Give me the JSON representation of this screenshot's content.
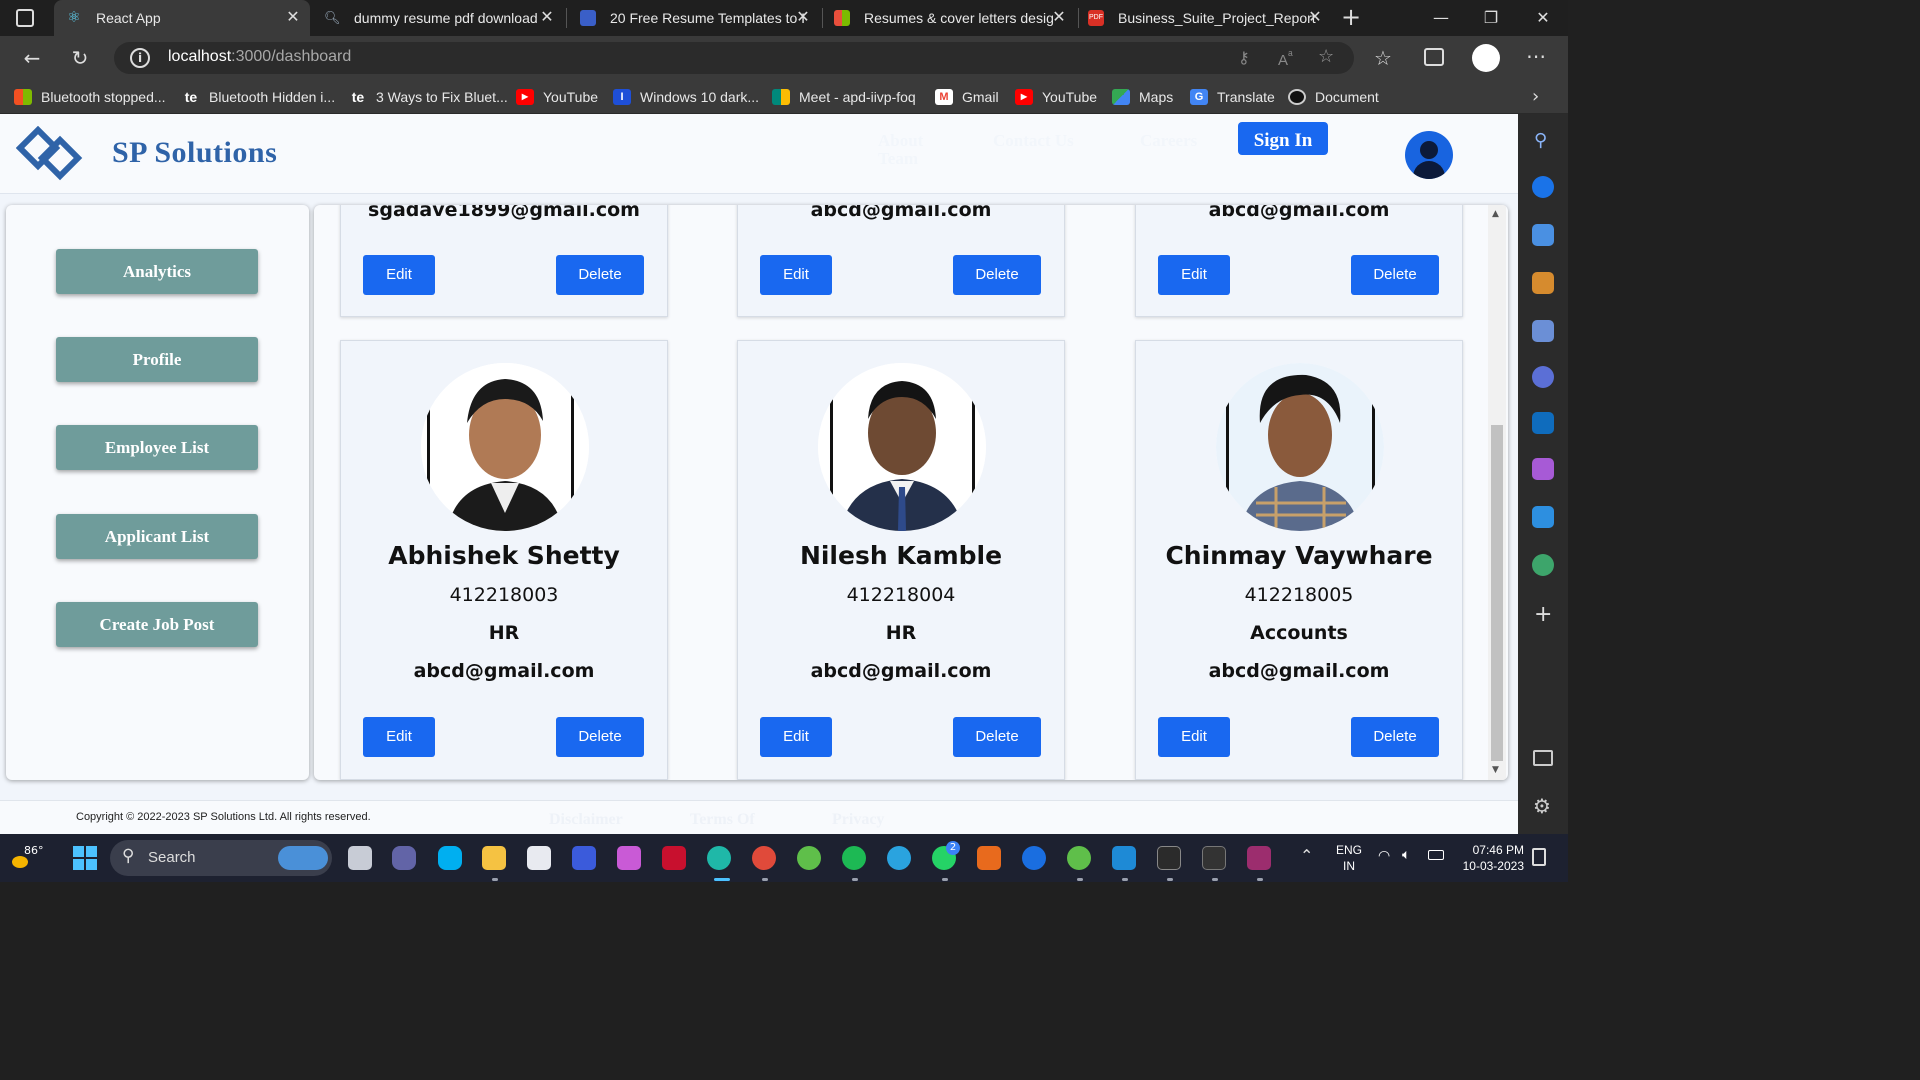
{
  "browser": {
    "tabs": [
      {
        "title": "React App",
        "favicon": "react-icon",
        "active": true
      },
      {
        "title": "dummy resume pdf download",
        "favicon": "search-icon",
        "active": false
      },
      {
        "title": "20 Free Resume Templates to I",
        "favicon": "document-icon",
        "active": false
      },
      {
        "title": "Resumes & cover letters desig",
        "favicon": "grid-icon",
        "active": false
      },
      {
        "title": "Business_Suite_Project_Report",
        "favicon": "pdf-icon",
        "active": false
      }
    ],
    "url_host": "localhost",
    "url_path": ":3000/dashboard",
    "bookmarks": [
      {
        "label": "Bluetooth stopped...",
        "icon": "windows-icon",
        "color": "#e74c3c"
      },
      {
        "label": "Bluetooth Hidden i...",
        "icon": "te-icon",
        "color": "#333333"
      },
      {
        "label": "3 Ways to Fix Bluet...",
        "icon": "te-icon",
        "color": "#333333"
      },
      {
        "label": "YouTube",
        "icon": "youtube-icon",
        "color": "#ff0000"
      },
      {
        "label": "Windows 10 dark...",
        "icon": "info-icon",
        "color": "#1e4fd8"
      },
      {
        "label": "Meet - apd-iivp-foq",
        "icon": "meet-icon",
        "color": "#00897b"
      },
      {
        "label": "Gmail",
        "icon": "gmail-icon",
        "color": "#ea4335"
      },
      {
        "label": "YouTube",
        "icon": "youtube-icon",
        "color": "#ff0000"
      },
      {
        "label": "Maps",
        "icon": "maps-icon",
        "color": "#34a853"
      },
      {
        "label": "Translate",
        "icon": "translate-icon",
        "color": "#4285f4"
      },
      {
        "label": "Document",
        "icon": "github-icon",
        "color": "#444444"
      }
    ]
  },
  "site": {
    "brand": "SP Solutions",
    "nav": [
      {
        "label": "About Team"
      },
      {
        "label": "Contact Us"
      },
      {
        "label": "Careers"
      }
    ],
    "signin_label": "Sign In",
    "sidebar": [
      {
        "label": "Analytics"
      },
      {
        "label": "Profile"
      },
      {
        "label": "Employee List"
      },
      {
        "label": "Applicant List"
      },
      {
        "label": "Create Job Post"
      }
    ],
    "top_cards": [
      {
        "email": "sgadave1899@gmail.com"
      },
      {
        "email": "abcd@gmail.com"
      },
      {
        "email": "abcd@gmail.com"
      }
    ],
    "employees": [
      {
        "name": "Abhishek Shetty",
        "id": "412218003",
        "dept": "HR",
        "email": "abcd@gmail.com",
        "shirt": "#1b1b1b"
      },
      {
        "name": "Nilesh Kamble",
        "id": "412218004",
        "dept": "HR",
        "email": "abcd@gmail.com",
        "shirt": "#24304a"
      },
      {
        "name": "Chinmay Vaywhare",
        "id": "412218005",
        "dept": "Accounts",
        "email": "abcd@gmail.com",
        "shirt": "#5a6b8c"
      }
    ],
    "edit_label": "Edit",
    "delete_label": "Delete",
    "copyright": "Copyright © 2022-2023 SP Solutions Ltd. All rights reserved.",
    "footer_links": [
      {
        "label": "Disclaimer"
      },
      {
        "label": "Terms Of"
      },
      {
        "label": "Privacy"
      }
    ]
  },
  "taskbar": {
    "weather_temp": "86°",
    "search_label": "Search",
    "lang_line1": "ENG",
    "lang_line2": "IN",
    "time": "07:46 PM",
    "date": "10-03-2023",
    "whatsapp_badge": "2"
  },
  "colors": {
    "accent": "#1968f0",
    "sidebar_button": "#6f9c9b",
    "brand": "#2f63a8"
  }
}
